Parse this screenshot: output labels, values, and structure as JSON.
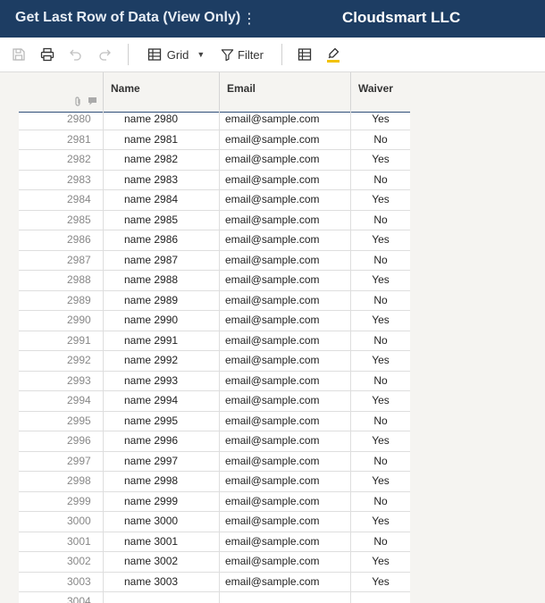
{
  "header": {
    "doc_title": "Get Last Row of Data (View Only)",
    "menu_glyph": "⋮",
    "org_name": "Cloudsmart LLC"
  },
  "toolbar": {
    "view_label": "Grid",
    "filter_label": "Filter",
    "icons": [
      "save-icon",
      "print-icon",
      "undo-icon",
      "redo-icon",
      "grid-view-icon",
      "filter-icon",
      "table-icon",
      "highlight-icon"
    ],
    "highlight_color": "#f2c200"
  },
  "grid": {
    "columns": [
      "Name",
      "Email",
      "Waiver"
    ],
    "rows": [
      {
        "num": "2980",
        "name": "name 2980",
        "email": "email@sample.com",
        "waiver": "Yes"
      },
      {
        "num": "2981",
        "name": "name 2981",
        "email": "email@sample.com",
        "waiver": "No"
      },
      {
        "num": "2982",
        "name": "name 2982",
        "email": "email@sample.com",
        "waiver": "Yes"
      },
      {
        "num": "2983",
        "name": "name 2983",
        "email": "email@sample.com",
        "waiver": "No"
      },
      {
        "num": "2984",
        "name": "name 2984",
        "email": "email@sample.com",
        "waiver": "Yes"
      },
      {
        "num": "2985",
        "name": "name 2985",
        "email": "email@sample.com",
        "waiver": "No"
      },
      {
        "num": "2986",
        "name": "name 2986",
        "email": "email@sample.com",
        "waiver": "Yes"
      },
      {
        "num": "2987",
        "name": "name 2987",
        "email": "email@sample.com",
        "waiver": "No"
      },
      {
        "num": "2988",
        "name": "name 2988",
        "email": "email@sample.com",
        "waiver": "Yes"
      },
      {
        "num": "2989",
        "name": "name 2989",
        "email": "email@sample.com",
        "waiver": "No"
      },
      {
        "num": "2990",
        "name": "name 2990",
        "email": "email@sample.com",
        "waiver": "Yes"
      },
      {
        "num": "2991",
        "name": "name 2991",
        "email": "email@sample.com",
        "waiver": "No"
      },
      {
        "num": "2992",
        "name": "name 2992",
        "email": "email@sample.com",
        "waiver": "Yes"
      },
      {
        "num": "2993",
        "name": "name 2993",
        "email": "email@sample.com",
        "waiver": "No"
      },
      {
        "num": "2994",
        "name": "name 2994",
        "email": "email@sample.com",
        "waiver": "Yes"
      },
      {
        "num": "2995",
        "name": "name 2995",
        "email": "email@sample.com",
        "waiver": "No"
      },
      {
        "num": "2996",
        "name": "name 2996",
        "email": "email@sample.com",
        "waiver": "Yes"
      },
      {
        "num": "2997",
        "name": "name 2997",
        "email": "email@sample.com",
        "waiver": "No"
      },
      {
        "num": "2998",
        "name": "name 2998",
        "email": "email@sample.com",
        "waiver": "Yes"
      },
      {
        "num": "2999",
        "name": "name 2999",
        "email": "email@sample.com",
        "waiver": "No"
      },
      {
        "num": "3000",
        "name": "name 3000",
        "email": "email@sample.com",
        "waiver": "Yes"
      },
      {
        "num": "3001",
        "name": "name 3001",
        "email": "email@sample.com",
        "waiver": "No"
      },
      {
        "num": "3002",
        "name": "name 3002",
        "email": "email@sample.com",
        "waiver": "Yes"
      },
      {
        "num": "3003",
        "name": "name 3003",
        "email": "email@sample.com",
        "waiver": "Yes"
      },
      {
        "num": "3004",
        "name": "",
        "email": "",
        "waiver": ""
      }
    ]
  }
}
